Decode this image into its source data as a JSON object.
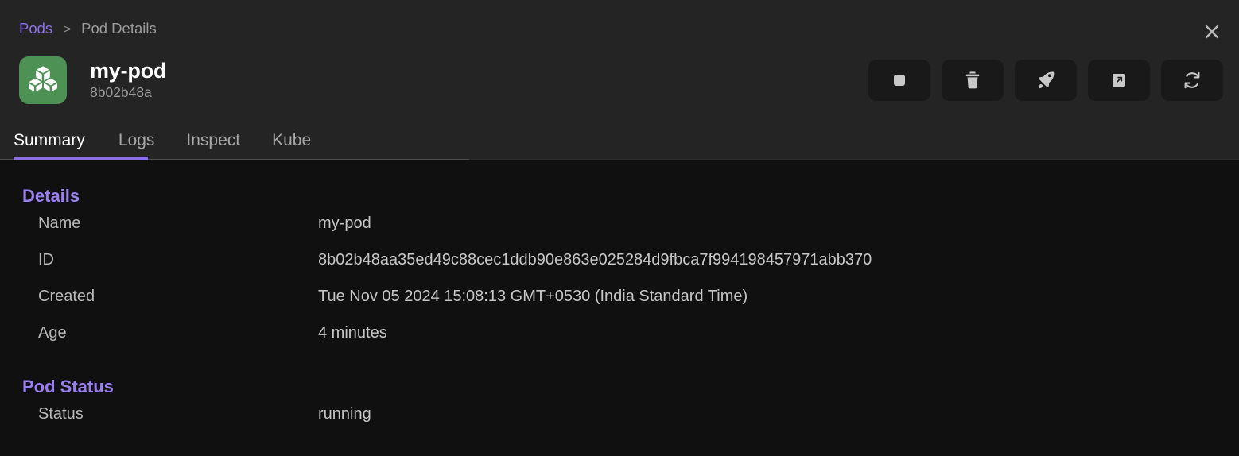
{
  "breadcrumb": {
    "parent": "Pods",
    "separator": ">",
    "current": "Pod Details"
  },
  "close_label": "close-icon",
  "pod": {
    "icon": "cubes-icon",
    "icon_bg": "#4d9154",
    "title": "my-pod",
    "short_id": "8b02b48a"
  },
  "actions": [
    {
      "name": "stop-button",
      "icon": "stop-square-icon"
    },
    {
      "name": "delete-button",
      "icon": "trash-icon"
    },
    {
      "name": "deploy-button",
      "icon": "rocket-icon"
    },
    {
      "name": "open-external-button",
      "icon": "external-link-icon"
    },
    {
      "name": "restart-button",
      "icon": "refresh-icon"
    }
  ],
  "tabs": [
    {
      "label": "Summary",
      "active": true
    },
    {
      "label": "Logs",
      "active": false
    },
    {
      "label": "Inspect",
      "active": false
    },
    {
      "label": "Kube",
      "active": false
    }
  ],
  "accent_color": "#8b6fe8",
  "sections": [
    {
      "title": "Details",
      "rows": [
        {
          "key": "Name",
          "value": "my-pod"
        },
        {
          "key": "ID",
          "value": "8b02b48aa35ed49c88cec1ddb90e863e025284d9fbca7f994198457971abb370"
        },
        {
          "key": "Created",
          "value": "Tue Nov 05 2024 15:08:13 GMT+0530 (India Standard Time)"
        },
        {
          "key": "Age",
          "value": "4 minutes"
        }
      ]
    },
    {
      "title": "Pod Status",
      "rows": [
        {
          "key": "Status",
          "value": "running"
        }
      ]
    }
  ]
}
